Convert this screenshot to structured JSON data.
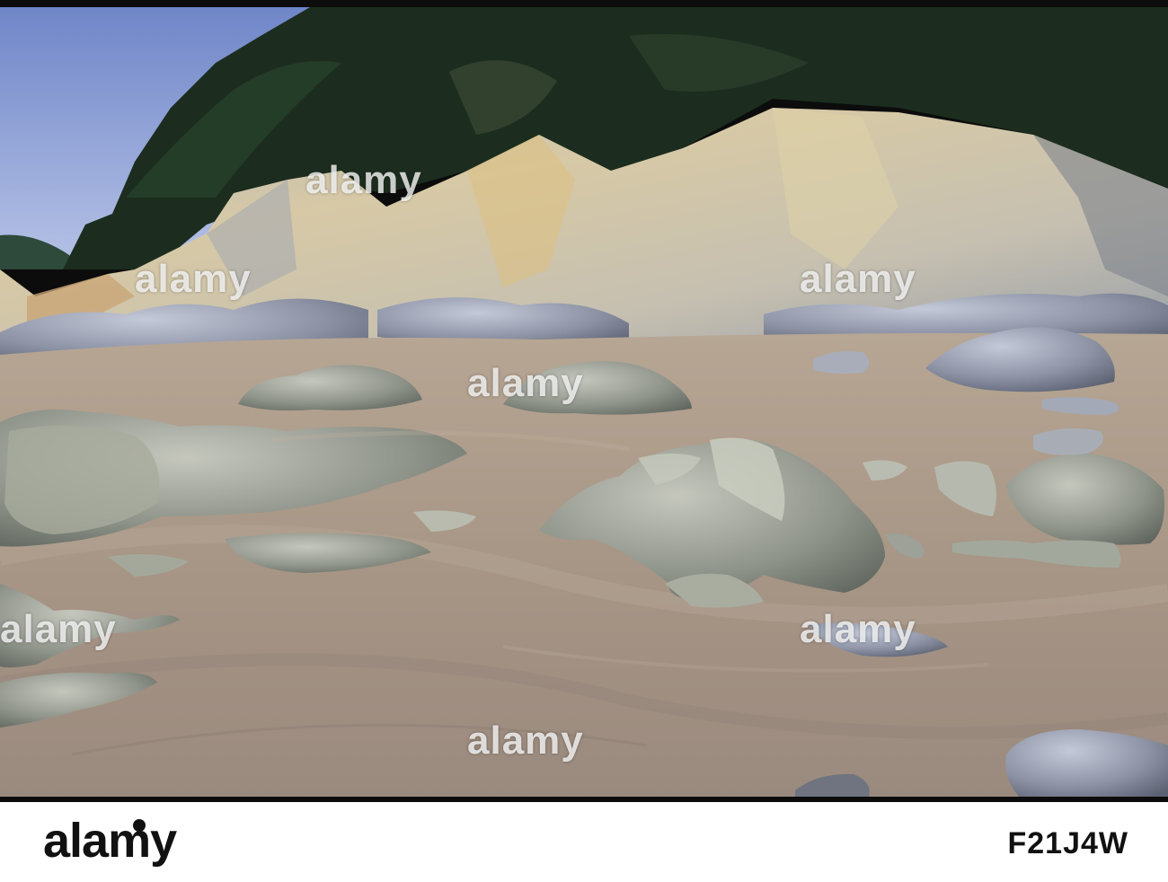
{
  "watermark": {
    "text": "alamy"
  },
  "footer": {
    "brand": "alamy",
    "image_id": "F21J4W"
  },
  "scene": {
    "sky_color": "#8ea2d6",
    "foliage_color": "#1f3322",
    "cliff_color": "#c9c1a7",
    "sand_color": "#a7978a",
    "rock_color": "#8d8f82"
  }
}
